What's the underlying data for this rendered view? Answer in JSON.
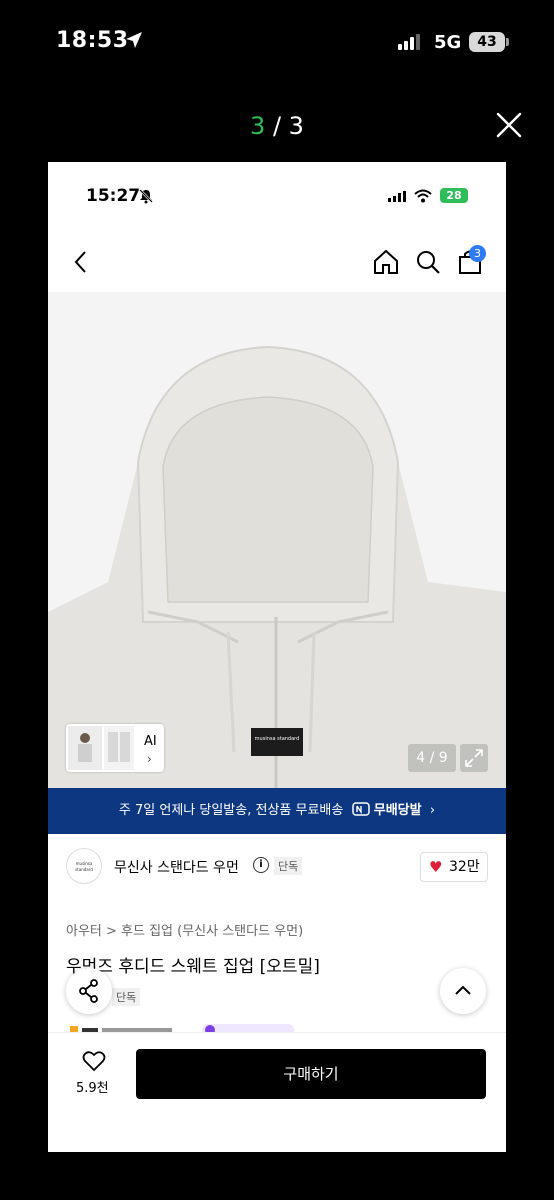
{
  "outer_status": {
    "time": "18:53",
    "network": "5G",
    "battery": "43"
  },
  "viewer": {
    "counter_current": "3",
    "counter_sep": " / ",
    "counter_total": "3",
    "close_icon": "close-icon"
  },
  "inner_status": {
    "time": "15:27",
    "battery": "28"
  },
  "inner_nav": {
    "cart_badge": "3"
  },
  "gallery": {
    "ai_label": "AI",
    "ai_chevron": "›",
    "image_counter": "4 / 9",
    "collar_label": "musinsa standard"
  },
  "banner": {
    "text": "주 7일 언제나 당일발송, 전상품 무료배송",
    "service": "무배당발",
    "chevron": "›"
  },
  "brand": {
    "logo_text": "musinsa standard",
    "name": "무신사 스탠다드 우먼",
    "info": "i",
    "badge": "단독",
    "likes": "32만"
  },
  "product": {
    "breadcrumb": "아우터 > 후드 집업 (무신사 스탠다드 우먼)",
    "title": "우먼즈 후디드 스웨트 집업 [오트밀]",
    "tag": "단독"
  },
  "bottom": {
    "wish_count": "5.9천",
    "buy_label": "구매하기"
  },
  "colors": {
    "accent_green": "#2ebd59",
    "banner_navy": "#0e3781",
    "cart_badge": "#2f7bf5",
    "heart_red": "#e01d3a"
  }
}
